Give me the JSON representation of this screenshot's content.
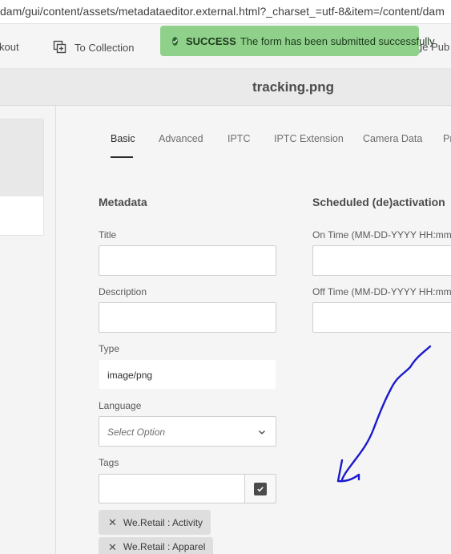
{
  "browser": {
    "url": "dam/gui/content/assets/metadataeditor.external.html?_charset_=utf-8&item=/content/dam"
  },
  "toolbar": {
    "checkout_label": "kout",
    "collection_label": "To Collection",
    "right_label": "ge Pub"
  },
  "toast": {
    "status": "SUCCESS",
    "message": "The form has been submitted successfully",
    "color": "#8fd18a"
  },
  "header": {
    "file_title": "tracking.png"
  },
  "tabs": [
    "Basic",
    "Advanced",
    "IPTC",
    "IPTC Extension",
    "Camera Data",
    "Pr"
  ],
  "metadata": {
    "heading": "Metadata",
    "title_label": "Title",
    "title_value": "",
    "description_label": "Description",
    "description_value": "",
    "type_label": "Type",
    "type_value": "image/png",
    "language_label": "Language",
    "language_placeholder": "Select Option",
    "tags_label": "Tags",
    "tags": [
      "We.Retail : Activity",
      "We.Retail : Apparel"
    ]
  },
  "scheduling": {
    "heading": "Scheduled (de)activation",
    "on_time_label": "On Time (MM-DD-YYYY HH:mm)",
    "off_time_label": "Off Time (MM-DD-YYYY HH:mm)"
  },
  "colors": {
    "annotation_stroke": "#1a1acc",
    "tab_active": "#2c2c2c"
  }
}
